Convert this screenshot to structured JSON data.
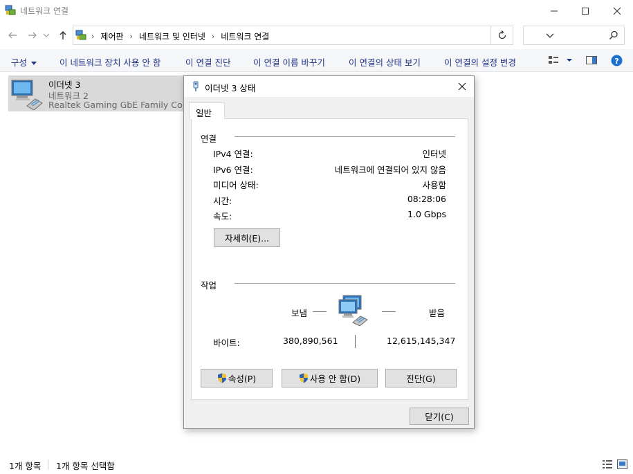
{
  "window": {
    "title": "네트워크 연결"
  },
  "address": {
    "crumbs": [
      "제어판",
      "네트워크 및 인터넷",
      "네트워크 연결"
    ]
  },
  "search": {
    "placeholder": ""
  },
  "commands": {
    "organize": "구성",
    "disable": "이 네트워크 장치 사용 안 함",
    "diagnose": "이 연결 진단",
    "rename": "이 연결 이름 바꾸기",
    "status": "이 연결의 상태 보기",
    "settings": "이 연결의 설정 변경"
  },
  "item": {
    "name": "이더넷 3",
    "network": "네트워크 2",
    "adapter": "Realtek Gaming GbE Family Cont..."
  },
  "statusbar": {
    "count": "1개 항목",
    "selected": "1개 항목 선택함"
  },
  "dialog": {
    "title": "이더넷 3 상태",
    "tab": "일반",
    "connection": {
      "group": "연결",
      "rows": [
        {
          "label": "IPv4 연결:",
          "value": "인터넷"
        },
        {
          "label": "IPv6 연결:",
          "value": "네트워크에 연결되어 있지 않음"
        },
        {
          "label": "미디어 상태:",
          "value": "사용함"
        },
        {
          "label": "시간:",
          "value": "08:28:06"
        },
        {
          "label": "속도:",
          "value": "1.0 Gbps"
        }
      ],
      "details_button": "자세히(E)..."
    },
    "activity": {
      "group": "작업",
      "sent_label": "보냄",
      "received_label": "받음",
      "bytes_label": "바이트:",
      "bytes_sent": "380,890,561",
      "bytes_received": "12,615,145,347"
    },
    "buttons": {
      "properties": "속성(P)",
      "disable": "사용 안 함(D)",
      "diagnose": "진단(G)",
      "close": "닫기(C)"
    }
  },
  "colors": {
    "command_text": "#1e3287",
    "help_blue": "#1a6fd0",
    "selection": "#d9d9d9"
  }
}
